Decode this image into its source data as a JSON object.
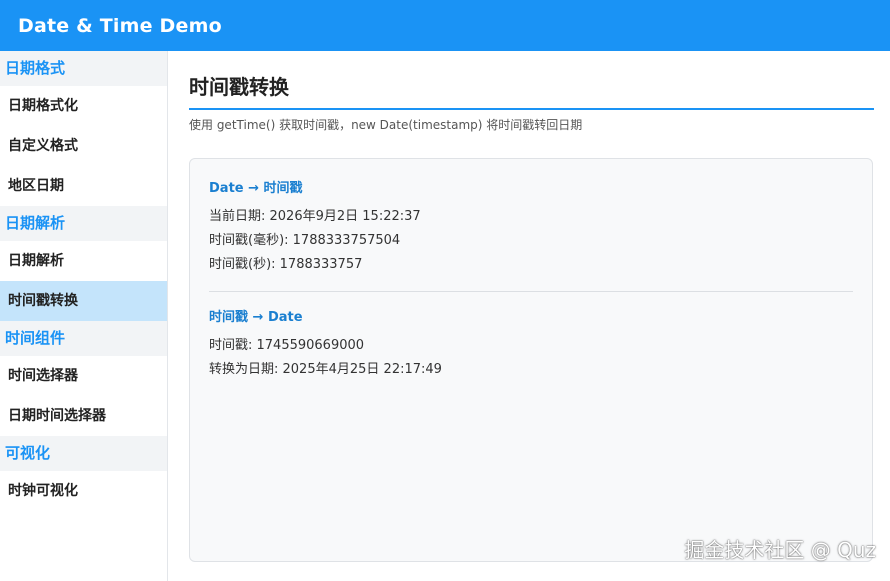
{
  "app": {
    "title": "Date & Time Demo"
  },
  "sidebar": {
    "groups": [
      {
        "title": "日期格式",
        "items": [
          "日期格式化",
          "自定义格式",
          "地区日期"
        ]
      },
      {
        "title": "日期解析",
        "items": [
          "日期解析",
          "时间戳转换"
        ]
      },
      {
        "title": "时间组件",
        "items": [
          "时间选择器",
          "日期时间选择器"
        ]
      },
      {
        "title": "可视化",
        "items": [
          "时钟可视化"
        ]
      }
    ],
    "active_item": "时间戳转换"
  },
  "main": {
    "title": "时间戳转换",
    "description": "使用 getTime() 获取时间戳，new Date(timestamp) 将时间戳转回日期",
    "sections": [
      {
        "title": "Date → 时间戳",
        "lines": [
          "当前日期: 2026年9月2日 15:22:37",
          "时间戳(毫秒): 1788333757504",
          "时间戳(秒): 1788333757"
        ]
      },
      {
        "title": "时间戳 → Date",
        "lines": [
          "时间戳: 1745590669000",
          "转换为日期: 2025年4月25日 22:17:49"
        ]
      }
    ]
  },
  "watermark": "掘金技术社区 @ Quz",
  "colors": {
    "accent": "#1a93f5",
    "active_bg": "#c4e4fb",
    "group_bg": "#f2f4f6"
  }
}
